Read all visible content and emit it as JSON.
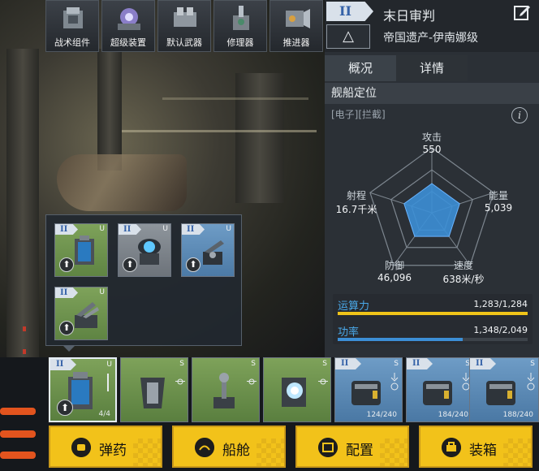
{
  "top_modules": [
    {
      "label": "战术组件",
      "icon": "tactical-component-icon"
    },
    {
      "label": "超级装置",
      "icon": "super-device-icon"
    },
    {
      "label": "默认武器",
      "icon": "default-weapon-icon"
    },
    {
      "label": "修理器",
      "icon": "repairer-icon"
    },
    {
      "label": "推进器",
      "icon": "thruster-icon"
    }
  ],
  "ship": {
    "tier": "II",
    "name": "末日审判",
    "class": "帝国遗产-伊南娜级",
    "collapse_symbol": "△"
  },
  "tabs": {
    "overview": "概况",
    "details": "详情"
  },
  "positioning": {
    "title": "舰船定位",
    "tags": "[电子][拦截]",
    "info_symbol": "i"
  },
  "radar": {
    "attack": {
      "label": "攻击",
      "value": "550",
      "level": 0.45
    },
    "energy": {
      "label": "能量",
      "value": "5,039",
      "level": 0.45
    },
    "speed": {
      "label": "速度",
      "value": "638米/秒",
      "level": 0.45
    },
    "defense": {
      "label": "防御",
      "value": "46,096",
      "level": 0.45
    },
    "range": {
      "label": "射程",
      "value": "16.7千米",
      "level": 0.45
    }
  },
  "resources": {
    "compute": {
      "label": "运算力",
      "value": "1,283/1,284",
      "fraction": 0.999,
      "color": "#f0c419"
    },
    "power": {
      "label": "功率",
      "value": "1,348/2,049",
      "fraction": 0.658,
      "color": "#3c8fd6"
    }
  },
  "popup_modules": [
    {
      "tier": "II",
      "type": "U",
      "color": "green",
      "upgrade": "⬆"
    },
    {
      "tier": "II",
      "type": "U",
      "color": "grey",
      "upgrade": "⬆"
    },
    {
      "tier": "II",
      "type": "U",
      "color": "blue",
      "upgrade": "⬆"
    },
    {
      "tier": "II",
      "type": "U",
      "color": "green",
      "upgrade": "⬆"
    }
  ],
  "slots": [
    {
      "tier": "II",
      "type": "U",
      "color": "green",
      "qty": "4/4",
      "upgrade": "⬆"
    },
    {
      "tier": "",
      "type": "S",
      "color": "green",
      "qty": ""
    },
    {
      "tier": "",
      "type": "S",
      "color": "green",
      "qty": ""
    },
    {
      "tier": "",
      "type": "S",
      "color": "green",
      "qty": ""
    },
    {
      "tier": "II",
      "type": "S",
      "color": "blue",
      "qty": "124/240"
    },
    {
      "tier": "II",
      "type": "S",
      "color": "blue",
      "qty": "184/240"
    },
    {
      "tier": "II",
      "type": "S",
      "color": "blue",
      "qty": "188/240"
    }
  ],
  "actions": [
    {
      "label": "弹药",
      "icon": "ammo-icon"
    },
    {
      "label": "船舱",
      "icon": "cabin-icon"
    },
    {
      "label": "配置",
      "icon": "config-icon"
    },
    {
      "label": "装箱",
      "icon": "pack-icon"
    }
  ]
}
